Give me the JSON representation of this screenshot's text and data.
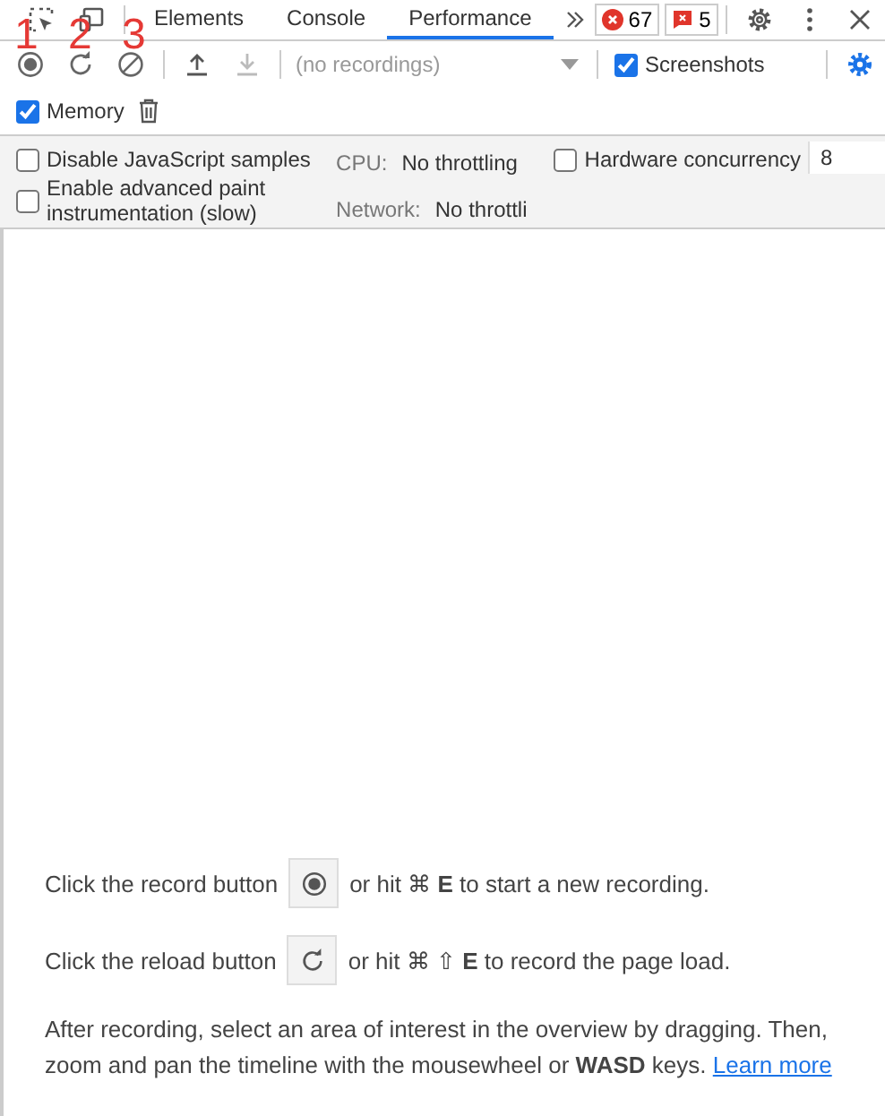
{
  "annotations": [
    "1",
    "2",
    "3"
  ],
  "tabs": [
    {
      "label": "Elements",
      "selected": false
    },
    {
      "label": "Console",
      "selected": false
    },
    {
      "label": "Performance",
      "selected": true
    }
  ],
  "errors": {
    "count": "67"
  },
  "warnings": {
    "count": "5"
  },
  "toolbar": {
    "recordings": {
      "value": "(no recordings)",
      "disabled": true
    },
    "screenshots": {
      "label": "Screenshots",
      "checked": true
    }
  },
  "memory": {
    "label": "Memory",
    "checked": true
  },
  "settings": {
    "options": [
      {
        "label": "Disable JavaScript samples",
        "checked": false
      },
      {
        "label": "Enable advanced paint instrumentation (slow)",
        "checked": false
      }
    ],
    "cpu": {
      "label": "CPU:",
      "value": "No throttling"
    },
    "hardware": {
      "label": "Hardware concurrency",
      "checked": false,
      "value": "8"
    },
    "network": {
      "label": "Network:",
      "value": "No throttli"
    }
  },
  "instructions": [
    {
      "kind": "record",
      "before": "Click the record button",
      "after": "or hit ⌘ **E** to start a new recording."
    },
    {
      "kind": "reload",
      "before": "Click the reload button",
      "after": "or hit ⌘ ⇧ **E** to record the page load."
    },
    {
      "kind": "text",
      "text": "After recording, select an area of interest in the overview by dragging. Then, zoom and pan the timeline with the mousewheel or **WASD** keys.",
      "link": "Learn more"
    }
  ]
}
